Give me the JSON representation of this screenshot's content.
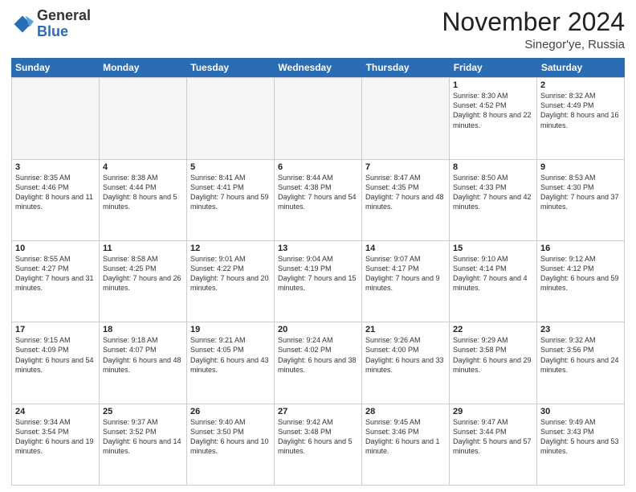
{
  "logo": {
    "general": "General",
    "blue": "Blue"
  },
  "title": "November 2024",
  "location": "Sinegor'ye, Russia",
  "header_days": [
    "Sunday",
    "Monday",
    "Tuesday",
    "Wednesday",
    "Thursday",
    "Friday",
    "Saturday"
  ],
  "weeks": [
    [
      {
        "day": "",
        "info": "",
        "empty": true
      },
      {
        "day": "",
        "info": "",
        "empty": true
      },
      {
        "day": "",
        "info": "",
        "empty": true
      },
      {
        "day": "",
        "info": "",
        "empty": true
      },
      {
        "day": "",
        "info": "",
        "empty": true
      },
      {
        "day": "1",
        "info": "Sunrise: 8:30 AM\nSunset: 4:52 PM\nDaylight: 8 hours and 22 minutes.",
        "empty": false
      },
      {
        "day": "2",
        "info": "Sunrise: 8:32 AM\nSunset: 4:49 PM\nDaylight: 8 hours and 16 minutes.",
        "empty": false
      }
    ],
    [
      {
        "day": "3",
        "info": "Sunrise: 8:35 AM\nSunset: 4:46 PM\nDaylight: 8 hours and 11 minutes.",
        "empty": false
      },
      {
        "day": "4",
        "info": "Sunrise: 8:38 AM\nSunset: 4:44 PM\nDaylight: 8 hours and 5 minutes.",
        "empty": false
      },
      {
        "day": "5",
        "info": "Sunrise: 8:41 AM\nSunset: 4:41 PM\nDaylight: 7 hours and 59 minutes.",
        "empty": false
      },
      {
        "day": "6",
        "info": "Sunrise: 8:44 AM\nSunset: 4:38 PM\nDaylight: 7 hours and 54 minutes.",
        "empty": false
      },
      {
        "day": "7",
        "info": "Sunrise: 8:47 AM\nSunset: 4:35 PM\nDaylight: 7 hours and 48 minutes.",
        "empty": false
      },
      {
        "day": "8",
        "info": "Sunrise: 8:50 AM\nSunset: 4:33 PM\nDaylight: 7 hours and 42 minutes.",
        "empty": false
      },
      {
        "day": "9",
        "info": "Sunrise: 8:53 AM\nSunset: 4:30 PM\nDaylight: 7 hours and 37 minutes.",
        "empty": false
      }
    ],
    [
      {
        "day": "10",
        "info": "Sunrise: 8:55 AM\nSunset: 4:27 PM\nDaylight: 7 hours and 31 minutes.",
        "empty": false
      },
      {
        "day": "11",
        "info": "Sunrise: 8:58 AM\nSunset: 4:25 PM\nDaylight: 7 hours and 26 minutes.",
        "empty": false
      },
      {
        "day": "12",
        "info": "Sunrise: 9:01 AM\nSunset: 4:22 PM\nDaylight: 7 hours and 20 minutes.",
        "empty": false
      },
      {
        "day": "13",
        "info": "Sunrise: 9:04 AM\nSunset: 4:19 PM\nDaylight: 7 hours and 15 minutes.",
        "empty": false
      },
      {
        "day": "14",
        "info": "Sunrise: 9:07 AM\nSunset: 4:17 PM\nDaylight: 7 hours and 9 minutes.",
        "empty": false
      },
      {
        "day": "15",
        "info": "Sunrise: 9:10 AM\nSunset: 4:14 PM\nDaylight: 7 hours and 4 minutes.",
        "empty": false
      },
      {
        "day": "16",
        "info": "Sunrise: 9:12 AM\nSunset: 4:12 PM\nDaylight: 6 hours and 59 minutes.",
        "empty": false
      }
    ],
    [
      {
        "day": "17",
        "info": "Sunrise: 9:15 AM\nSunset: 4:09 PM\nDaylight: 6 hours and 54 minutes.",
        "empty": false
      },
      {
        "day": "18",
        "info": "Sunrise: 9:18 AM\nSunset: 4:07 PM\nDaylight: 6 hours and 48 minutes.",
        "empty": false
      },
      {
        "day": "19",
        "info": "Sunrise: 9:21 AM\nSunset: 4:05 PM\nDaylight: 6 hours and 43 minutes.",
        "empty": false
      },
      {
        "day": "20",
        "info": "Sunrise: 9:24 AM\nSunset: 4:02 PM\nDaylight: 6 hours and 38 minutes.",
        "empty": false
      },
      {
        "day": "21",
        "info": "Sunrise: 9:26 AM\nSunset: 4:00 PM\nDaylight: 6 hours and 33 minutes.",
        "empty": false
      },
      {
        "day": "22",
        "info": "Sunrise: 9:29 AM\nSunset: 3:58 PM\nDaylight: 6 hours and 29 minutes.",
        "empty": false
      },
      {
        "day": "23",
        "info": "Sunrise: 9:32 AM\nSunset: 3:56 PM\nDaylight: 6 hours and 24 minutes.",
        "empty": false
      }
    ],
    [
      {
        "day": "24",
        "info": "Sunrise: 9:34 AM\nSunset: 3:54 PM\nDaylight: 6 hours and 19 minutes.",
        "empty": false
      },
      {
        "day": "25",
        "info": "Sunrise: 9:37 AM\nSunset: 3:52 PM\nDaylight: 6 hours and 14 minutes.",
        "empty": false
      },
      {
        "day": "26",
        "info": "Sunrise: 9:40 AM\nSunset: 3:50 PM\nDaylight: 6 hours and 10 minutes.",
        "empty": false
      },
      {
        "day": "27",
        "info": "Sunrise: 9:42 AM\nSunset: 3:48 PM\nDaylight: 6 hours and 5 minutes.",
        "empty": false
      },
      {
        "day": "28",
        "info": "Sunrise: 9:45 AM\nSunset: 3:46 PM\nDaylight: 6 hours and 1 minute.",
        "empty": false
      },
      {
        "day": "29",
        "info": "Sunrise: 9:47 AM\nSunset: 3:44 PM\nDaylight: 5 hours and 57 minutes.",
        "empty": false
      },
      {
        "day": "30",
        "info": "Sunrise: 9:49 AM\nSunset: 3:43 PM\nDaylight: 5 hours and 53 minutes.",
        "empty": false
      }
    ]
  ]
}
